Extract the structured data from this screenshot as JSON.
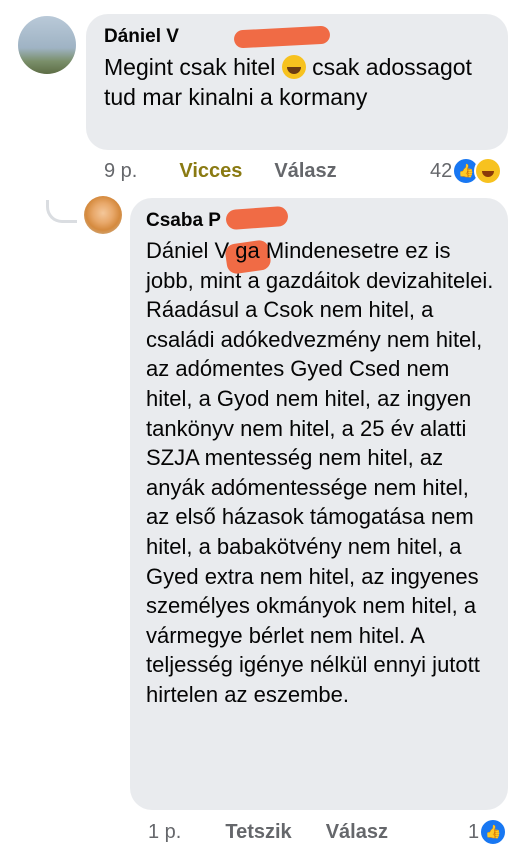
{
  "comment": {
    "author": "Dániel V",
    "text_before_emoji": "Megint csak hitel ",
    "emoji": "grinning-face-emoji",
    "text_after_emoji": " csak adossagot tud mar kinalni a kormany",
    "time": "9 p.",
    "reaction_label": "Vicces",
    "reply_label": "Válasz",
    "reaction_count": "42",
    "reaction_icons": [
      "like-icon",
      "haha-icon"
    ]
  },
  "reply": {
    "author": "Csaba P",
    "text": "Dániel V ga Mindenesetre ez is jobb, mint a gazdáitok devizahitelei. Ráadásul a Csok nem hitel, a családi adókedvezmény nem hitel, az adómentes Gyed Csed nem hitel, a Gyod nem hitel, az ingyen tankönyv nem hitel, a 25 év alatti SZJA mentesség nem hitel, az anyák adómentessége nem hitel, az első házasok támogatása nem hitel, a babakötvény nem hitel, a Gyed extra nem hitel, az ingyenes személyes okmányok nem hitel, a vármegye bérlet nem hitel. A teljesség igénye nélkül ennyi jutott hirtelen az eszembe.",
    "time": "1 p.",
    "reaction_label": "Tetszik",
    "reply_label": "Válasz",
    "reaction_count": "1",
    "reaction_icons": [
      "like-icon"
    ]
  },
  "colors": {
    "bubble": "#e9ebee",
    "meta_text": "#65676b",
    "vicces": "#8a7a12",
    "like_blue": "#1877f2",
    "redaction": "#f06b45"
  }
}
